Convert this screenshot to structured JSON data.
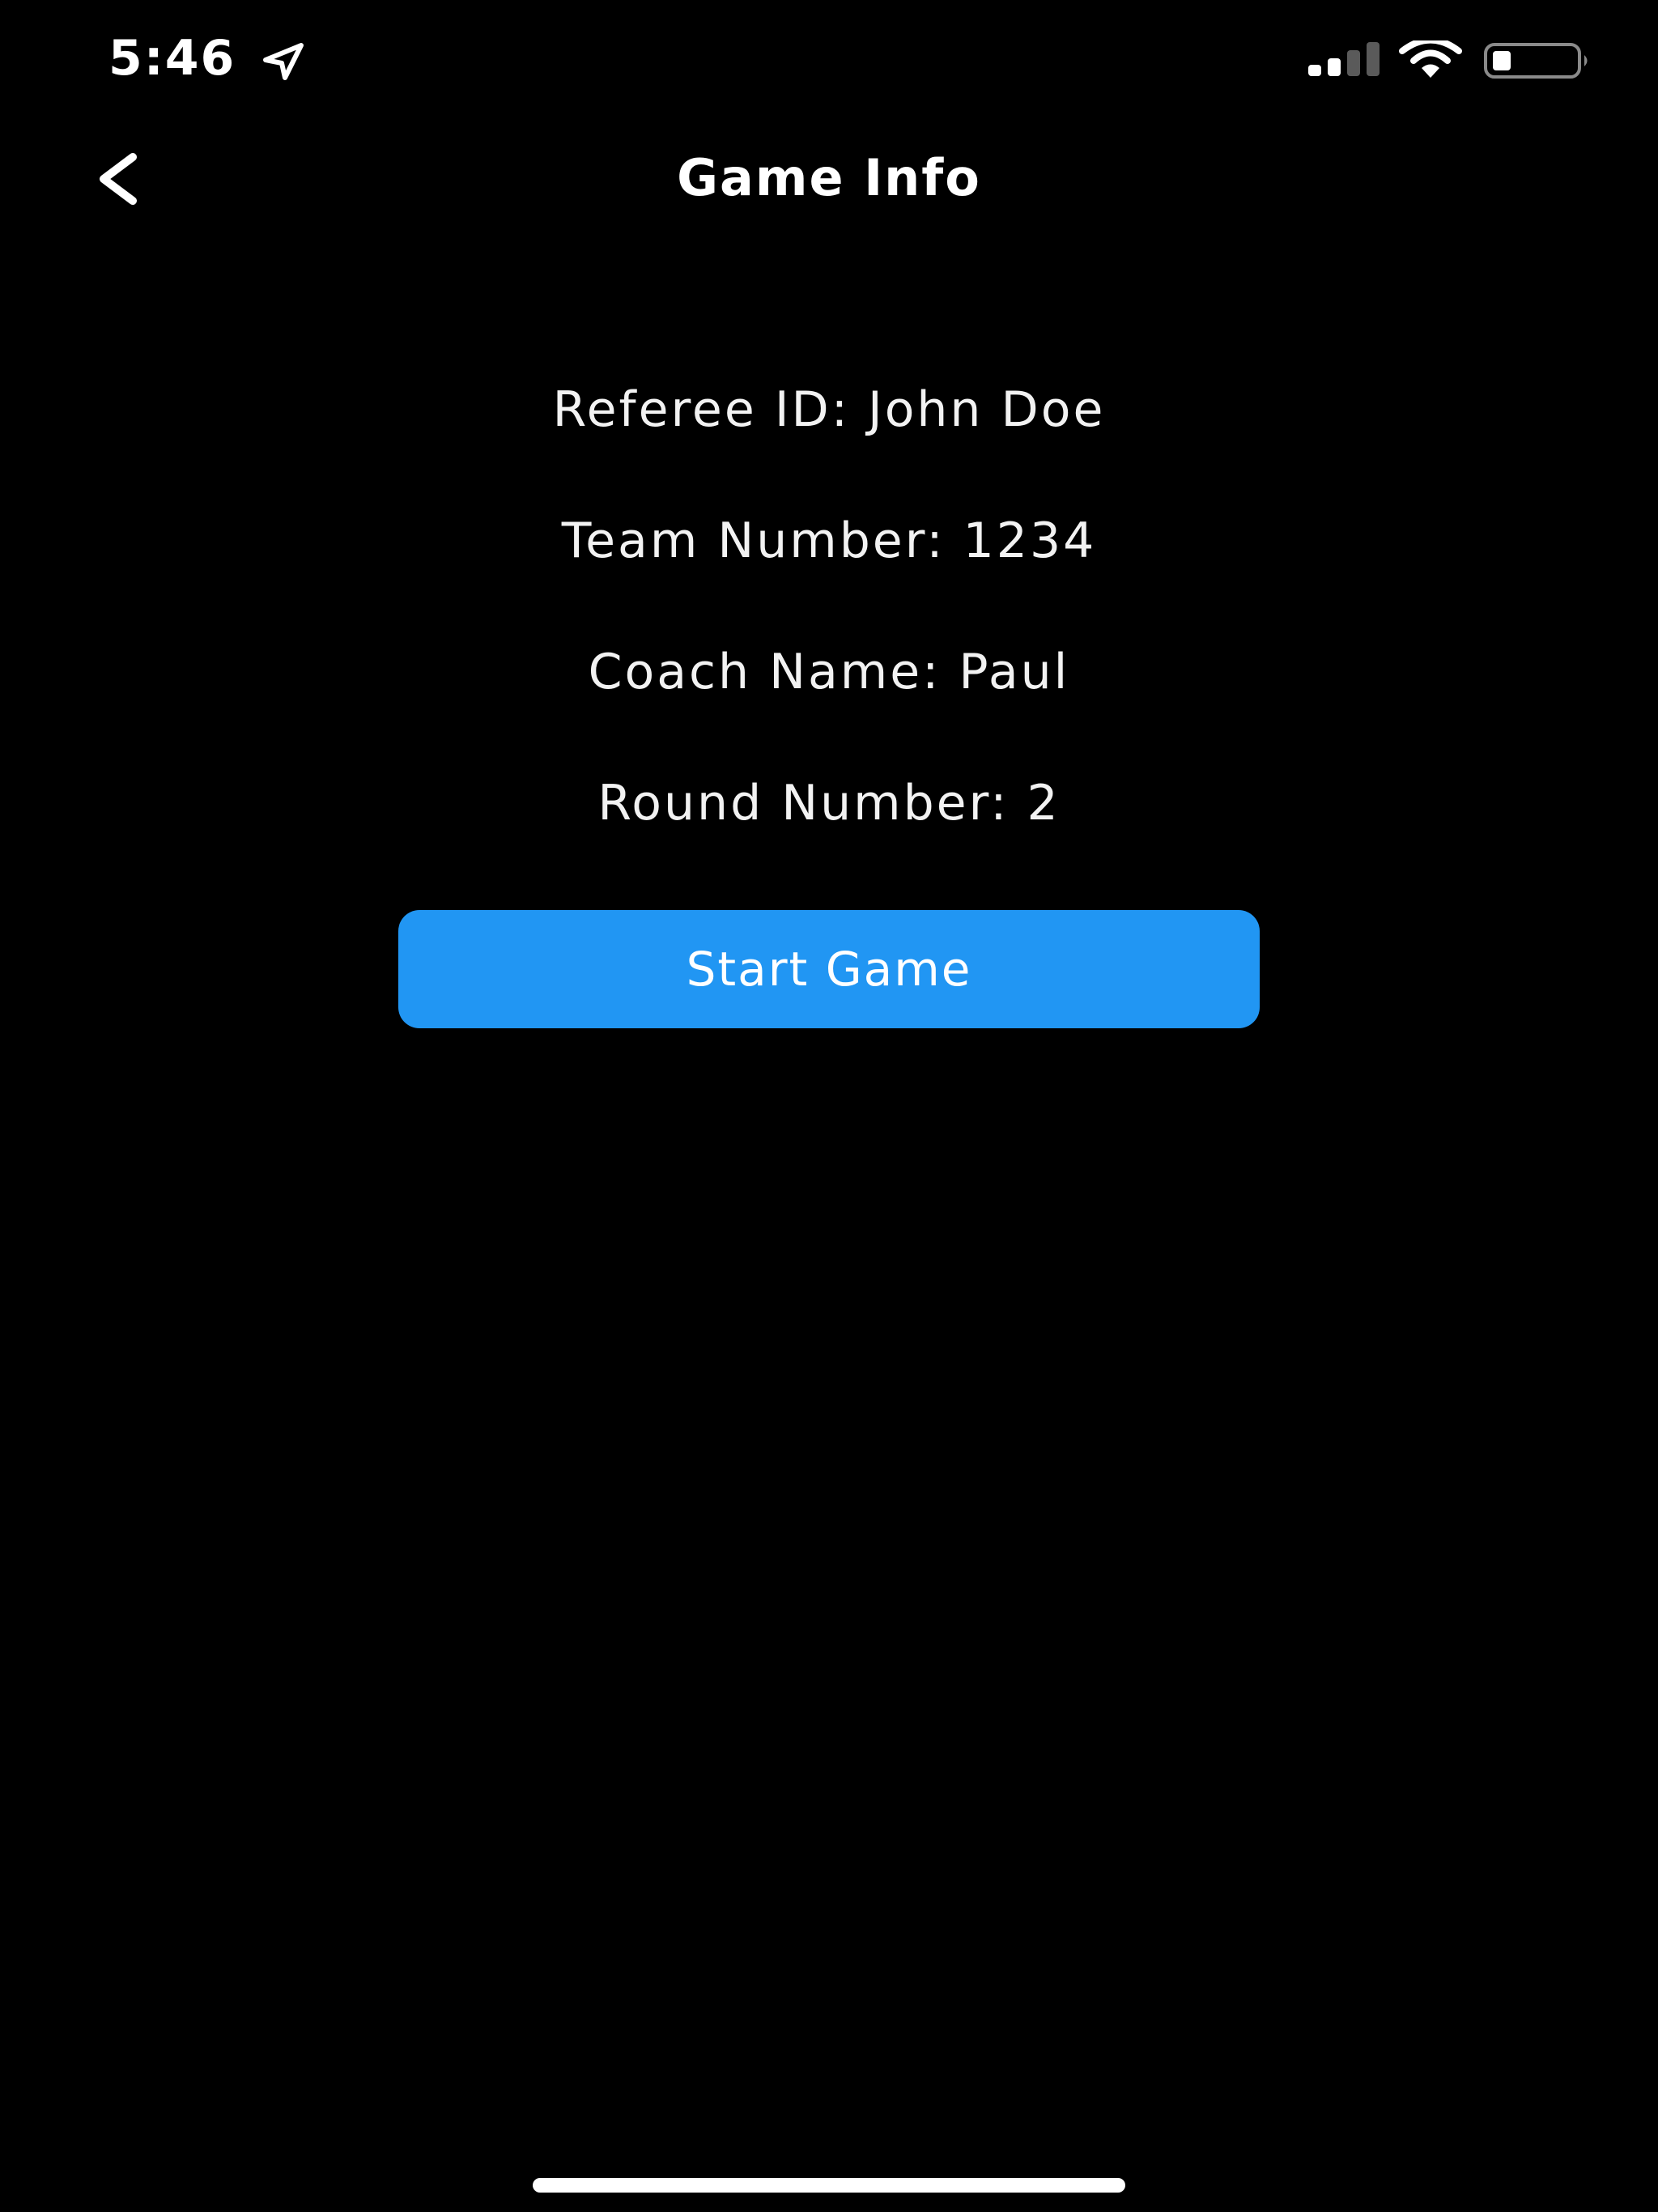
{
  "status_bar": {
    "time": "5:46",
    "icons": [
      "location-arrow-icon",
      "cellular-signal-icon",
      "wifi-icon",
      "battery-icon"
    ]
  },
  "nav": {
    "back_icon": "chevron-left-icon",
    "title": "Game Info"
  },
  "game_info": {
    "referee": "Referee ID: John Doe",
    "team_number": "Team Number: 1234",
    "coach_name": "Coach Name: Paul",
    "round_number": "Round Number: 2"
  },
  "actions": {
    "start_label": "Start Game"
  },
  "colors": {
    "background": "#000000",
    "text": "#ffffff",
    "accent": "#2196f3"
  }
}
